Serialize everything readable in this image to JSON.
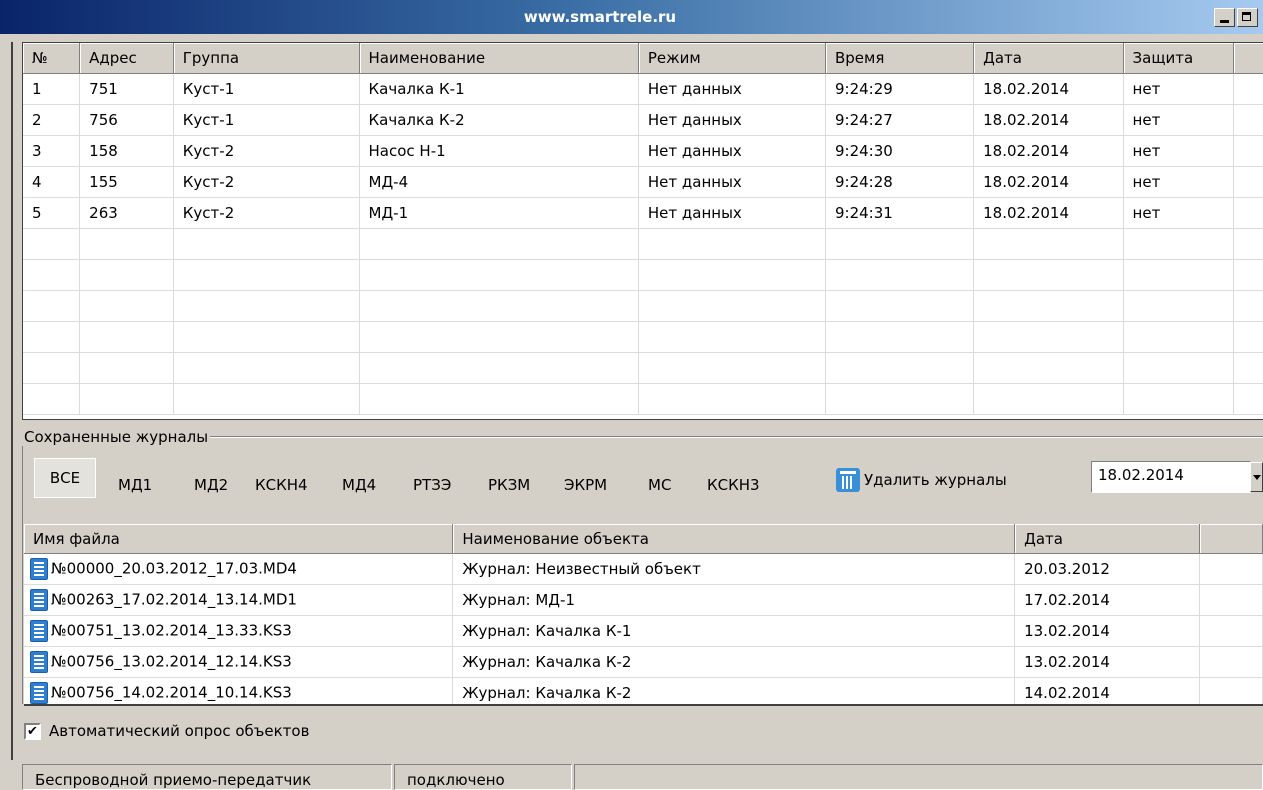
{
  "window": {
    "title": "www.smartrele.ru"
  },
  "objects_table": {
    "columns": [
      "№",
      "Адрес",
      "Группа",
      "Наименование",
      "Режим",
      "Время",
      "Дата",
      "Защита"
    ],
    "rows": [
      [
        "1",
        "751",
        "Куст-1",
        "Качалка К-1",
        "Нет данных",
        "9:24:29",
        "18.02.2014",
        "нет"
      ],
      [
        "2",
        "756",
        "Куст-1",
        "Качалка К-2",
        "Нет данных",
        "9:24:27",
        "18.02.2014",
        "нет"
      ],
      [
        "3",
        "158",
        "Куст-2",
        "Насос Н-1",
        "Нет данных",
        "9:24:30",
        "18.02.2014",
        "нет"
      ],
      [
        "4",
        "155",
        "Куст-2",
        "МД-4",
        "Нет данных",
        "9:24:28",
        "18.02.2014",
        "нет"
      ],
      [
        "5",
        "263",
        "Куст-2",
        "МД-1",
        "Нет данных",
        "9:24:31",
        "18.02.2014",
        "нет"
      ]
    ]
  },
  "saved_logs": {
    "group_label": "Сохраненные журналы",
    "filters": [
      "ВСЕ",
      "МД1",
      "МД2",
      "КСКН4",
      "МД4",
      "РТЗЭ",
      "РКЗМ",
      "ЭКРМ",
      "МС",
      "КСКН3"
    ],
    "active_filter": "ВСЕ",
    "delete_label": "Удалить журналы",
    "date_value": "18.02.2014",
    "columns": [
      "Имя файла",
      "Наименование объекта",
      "Дата"
    ],
    "rows": [
      [
        "№00000_20.03.2012_17.03.MD4",
        "Журнал: Неизвестный объект",
        "20.03.2012"
      ],
      [
        "№00263_17.02.2014_13.14.MD1",
        "Журнал: МД-1",
        "17.02.2014"
      ],
      [
        "№00751_13.02.2014_13.33.KS3",
        "Журнал: Качалка К-1",
        "13.02.2014"
      ],
      [
        "№00756_13.02.2014_12.14.KS3",
        "Журнал: Качалка К-2",
        "13.02.2014"
      ],
      [
        "№00756_14.02.2014_10.14.KS3",
        "Журнал: Качалка К-2",
        "14.02.2014"
      ]
    ]
  },
  "auto_poll": {
    "label": "Автоматический опрос объектов",
    "checked": true
  },
  "status_bar": {
    "device": "Беспроводной приемо-передатчик",
    "state": "подключено"
  },
  "icons": {
    "file": "document-icon",
    "delete": "trash-icon",
    "checkbox": "check-icon"
  }
}
